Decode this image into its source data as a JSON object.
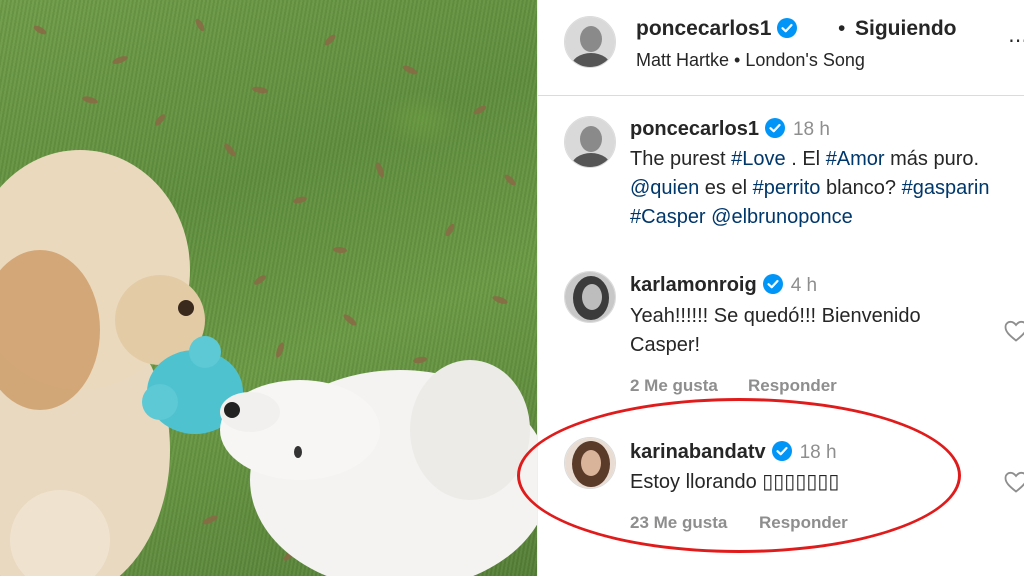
{
  "post": {
    "header": {
      "username": "poncecarlos1",
      "separator": "•",
      "follow_status": "Siguiendo",
      "audio": "Matt Hartke • London's Song",
      "more_icon": "more-options-icon"
    },
    "caption": {
      "username": "poncecarlos1",
      "time": "18 h",
      "text_parts": [
        {
          "t": "The purest ",
          "tag": false
        },
        {
          "t": "#Love",
          "tag": true
        },
        {
          "t": " . El ",
          "tag": false
        },
        {
          "t": "#Amor",
          "tag": true
        },
        {
          "t": " más puro. ",
          "tag": false
        },
        {
          "t": "@quien",
          "tag": true
        },
        {
          "t": " es el ",
          "tag": false
        },
        {
          "t": "#perrito",
          "tag": true
        },
        {
          "t": " blanco? ",
          "tag": false
        },
        {
          "t": "#gasparin",
          "tag": true
        },
        {
          "t": " ",
          "tag": false
        },
        {
          "t": "#Casper",
          "tag": true
        },
        {
          "t": " ",
          "tag": false
        },
        {
          "t": "@elbrunoponce",
          "tag": true
        }
      ]
    },
    "comments": [
      {
        "username": "karlamonroig",
        "time": "4 h",
        "text_line1": "Yeah!!!!!! Se quedó!!! Bienvenido",
        "text_line2": "Casper!",
        "likes": "2 Me gusta",
        "reply": "Responder"
      },
      {
        "username": "karinabandatv",
        "time": "18 h",
        "text_line1": "Estoy llorando ▯▯▯▯▯▯▯",
        "likes": "23 Me gusta",
        "reply": "Responder"
      }
    ],
    "colors": {
      "verified": "#0095f6",
      "hashtag": "#00376b",
      "highlight": "#e01b1b",
      "muted": "#8e8e8e"
    }
  }
}
